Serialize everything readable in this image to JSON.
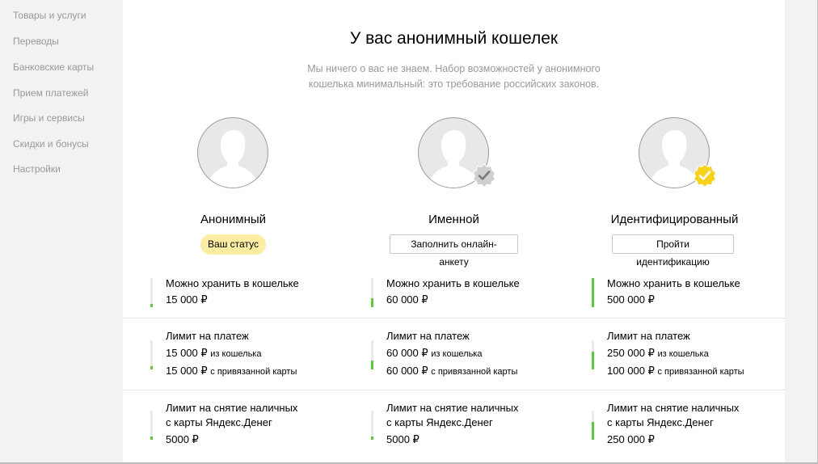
{
  "sidebar": {
    "items": [
      {
        "label": "Товары и услуги"
      },
      {
        "label": "Переводы"
      },
      {
        "label": "Банковские карты"
      },
      {
        "label": "Прием платежей"
      },
      {
        "label": "Игры и сервисы"
      },
      {
        "label": "Скидки и бонусы"
      },
      {
        "label": "Настройки"
      }
    ]
  },
  "header": {
    "title": "У вас анонимный кошелек",
    "subtitle_line1": "Мы ничего о вас не знаем. Набор возможностей у анонимного",
    "subtitle_line2": "кошелька минимальный: это требование российских законов."
  },
  "colors": {
    "accent_green": "#5fc83c",
    "status_yellow": "#fdeda3",
    "badge_gold": "#f7d21c"
  },
  "tiers": [
    {
      "name": "Анонимный",
      "badge_icon": "none",
      "status_label": "Ваш статус",
      "storage_label": "Можно хранить в кошельке",
      "storage_value": "15 000 ₽",
      "storage_level": 0.1,
      "payment_label": "Лимит на платеж",
      "payment_wallet_value": "15 000 ₽",
      "payment_wallet_note": "из кошелька",
      "payment_card_value": "15 000 ₽",
      "payment_card_note": "с привязанной карты",
      "payment_level": 0.1,
      "cash_label_line1": "Лимит на снятие наличных",
      "cash_label_line2": "с карты Яндекс.Денег",
      "cash_value": "5000 ₽",
      "cash_level": 0.1
    },
    {
      "name": "Именной",
      "badge_icon": "grey-check-badge-icon",
      "button_label": "Заполнить онлайн-анкету",
      "storage_label": "Можно хранить в кошельке",
      "storage_value": "60 000 ₽",
      "storage_level": 0.3,
      "payment_label": "Лимит на платеж",
      "payment_wallet_value": "60 000 ₽",
      "payment_wallet_note": "из кошелька",
      "payment_card_value": "60 000 ₽",
      "payment_card_note": "с привязанной карты",
      "payment_level": 0.3,
      "cash_label_line1": "Лимит на снятие наличных",
      "cash_label_line2": "с карты Яндекс.Денег",
      "cash_value": "5000 ₽",
      "cash_level": 0.1
    },
    {
      "name": "Идентифицированный",
      "badge_icon": "gold-check-badge-icon",
      "button_label": "Пройти идентификацию",
      "storage_label": "Можно хранить в кошельке",
      "storage_value": "500 000 ₽",
      "storage_level": 1.0,
      "payment_label": "Лимит на платеж",
      "payment_wallet_value": "250 000 ₽",
      "payment_wallet_note": "из кошелька",
      "payment_card_value": "100 000 ₽",
      "payment_card_note": "с привязанной карты",
      "payment_level": 0.6,
      "cash_label_line1": "Лимит на снятие наличных",
      "cash_label_line2": "с карты Яндекс.Денег",
      "cash_value": "250 000 ₽",
      "cash_level": 0.6
    }
  ]
}
